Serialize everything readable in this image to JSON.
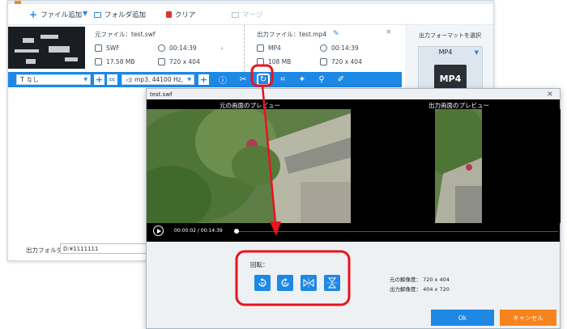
{
  "toolbar": {
    "add_file": "ファイル追加",
    "add_folder": "フォルダ追加",
    "clear": "クリア",
    "merge": "マージ"
  },
  "source": {
    "label": "元ファイル：test.swf",
    "format": "SWF",
    "duration": "00:14:39",
    "size": "17.58 MB",
    "resolution": "720 x 404"
  },
  "output": {
    "label": "出力ファイル：test.mp4",
    "format": "MP4",
    "duration": "00:14:39",
    "size": "108 MB",
    "resolution": "720 x 404"
  },
  "edit_bar": {
    "subtitle_value": "なし",
    "audio_value": "mp3, 44100 Hz,"
  },
  "side_panel": {
    "title": "出力フォーマットを選択",
    "format": "MP4",
    "tile_text": "MP4"
  },
  "output_folder": {
    "label": "出力フォルダ：",
    "value": "D:¥1111111"
  },
  "dialog": {
    "title": "test.swf",
    "original_preview_title": "元の画面のプレビュー",
    "output_preview_title": "出力画面のプレビュー",
    "time": "00:00:02 / 00:14:39",
    "playback_progress": 0.002,
    "rotate_label": "回転：",
    "original_resolution_label": "元の解像度：",
    "original_resolution": "720 x 404",
    "output_resolution_label": "出力解像度：",
    "output_resolution": "404 x 720",
    "ok": "Ok",
    "cancel": "キャンセル"
  },
  "colors": {
    "accent_blue": "#1e88e5",
    "cancel_orange": "#f7831d",
    "annotation_red": "#e8141e"
  },
  "icons": {
    "rotate_ccw": "rotate-left-90-icon",
    "rotate_cw": "rotate-right-90-icon",
    "flip_h": "flip-horizontal-icon",
    "flip_v": "flip-vertical-icon"
  }
}
